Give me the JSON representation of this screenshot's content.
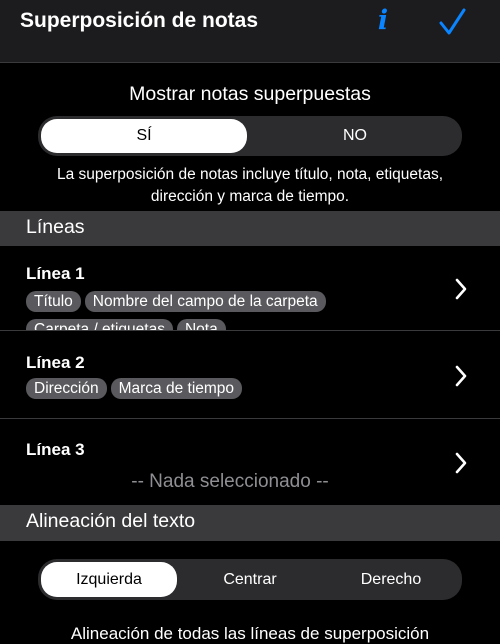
{
  "header": {
    "title": "Superposición de notas",
    "info_label": "i",
    "info_icon": "info-icon",
    "done_icon": "checkmark-icon",
    "accent_color": "#0a84ff"
  },
  "overlay_toggle": {
    "label": "Mostrar notas superpuestas",
    "options": [
      "SÍ",
      "NO"
    ],
    "selected": "SÍ",
    "description": "La superposición de notas incluye título, nota, etiquetas, dirección y marca de tiempo."
  },
  "lines_section": {
    "header": "Líneas",
    "rows": [
      {
        "title": "Línea 1",
        "tags": [
          "Título",
          "Nombre del campo de la carpeta",
          "Carpeta / etiquetas",
          "Nota"
        ]
      },
      {
        "title": "Línea 2",
        "tags": [
          "Dirección",
          "Marca de tiempo"
        ]
      },
      {
        "title": "Línea 3",
        "empty_text": "-- Nada seleccionado --"
      }
    ]
  },
  "alignment_section": {
    "header": "Alineación del texto",
    "options": [
      "Izquierda",
      "Centrar",
      "Derecho"
    ],
    "selected": "Izquierda",
    "description": "Alineación de todas las líneas de superposición"
  }
}
